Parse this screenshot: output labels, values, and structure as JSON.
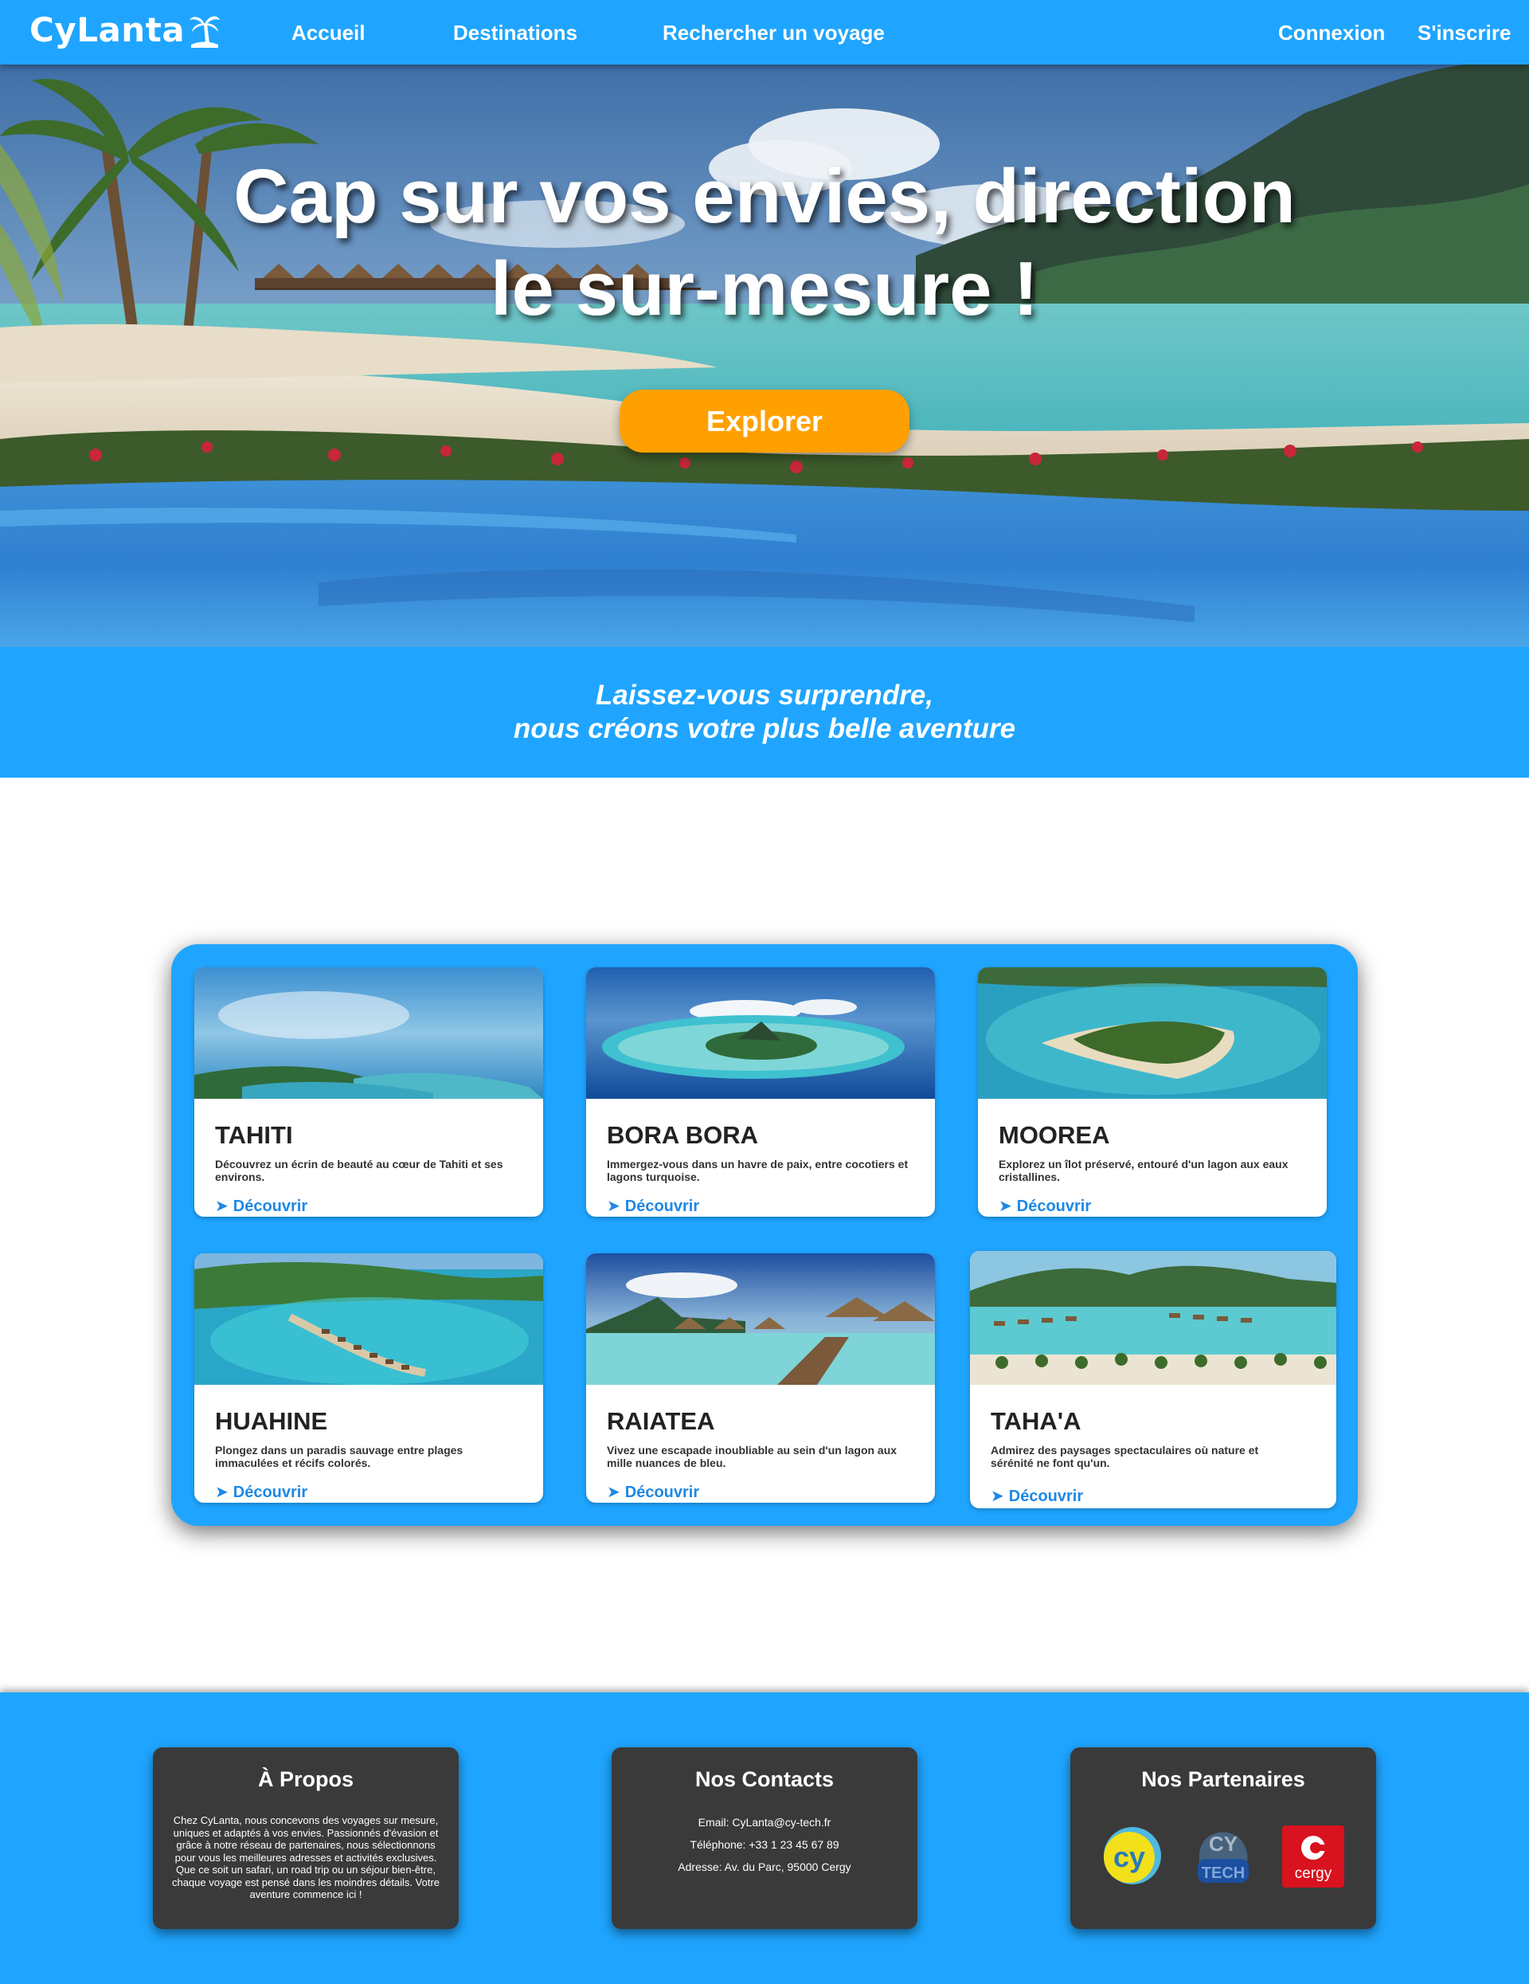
{
  "nav": {
    "brand": "CyLanta",
    "links": [
      "Accueil",
      "Destinations",
      "Rechercher un voyage"
    ],
    "login": "Connexion",
    "signup": "S'inscrire"
  },
  "hero": {
    "title_line1": "Cap sur vos envies, direction",
    "title_line2": "le sur-mesure !",
    "cta": "Explorer"
  },
  "tagline": {
    "line1": "Laissez-vous surprendre,",
    "line2": "nous créons votre plus belle aventure"
  },
  "destinations": [
    {
      "name": "TAHITI",
      "desc": "Découvrez un écrin de beauté au cœur de Tahiti et ses environs.",
      "link": "Découvrir"
    },
    {
      "name": "BORA BORA",
      "desc": "Immergez-vous dans un havre de paix, entre cocotiers et lagons turquoise.",
      "link": "Découvrir"
    },
    {
      "name": "MOOREA",
      "desc": "Explorez un îlot préservé, entouré d'un lagon aux eaux cristallines.",
      "link": "Découvrir"
    },
    {
      "name": "HUAHINE",
      "desc": "Plongez dans un paradis sauvage entre plages immaculées et récifs colorés.",
      "link": "Découvrir"
    },
    {
      "name": "RAIATEA",
      "desc": "Vivez une escapade inoubliable au sein d'un lagon aux mille nuances de bleu.",
      "link": "Découvrir"
    },
    {
      "name": "TAHA'A",
      "desc": "Admirez des paysages spectaculaires où nature et sérénité ne font qu'un.",
      "link": "Découvrir"
    }
  ],
  "footer": {
    "about": {
      "title": "À Propos",
      "text": "Chez CyLanta, nous concevons des voyages sur mesure, uniques et adaptés à vos envies. Passionnés d'évasion et grâce à notre réseau de partenaires, nous sélectionnons pour vous les meilleures adresses et activités exclusives. Que ce soit un safari, un road trip ou un séjour bien-être, chaque voyage est pensé dans les moindres détails. Votre aventure commence ici !"
    },
    "contacts": {
      "title": "Nos Contacts",
      "email": "Email: CyLanta@cy-tech.fr",
      "phone": "Téléphone: +33 1 23 45 67 89",
      "address": "Adresse: Av. du Parc, 95000 Cergy"
    },
    "partners": {
      "title": "Nos Partenaires",
      "logos": [
        "cy",
        "TECH",
        "cergy"
      ]
    }
  },
  "colors": {
    "primary_blue": "#1fa5ff",
    "cta_orange": "#ffa000",
    "link_blue": "#1e88e5",
    "footer_box": "#3a3a3a"
  },
  "icons": [
    "palm-tree-icon",
    "arrow-right-icon"
  ]
}
